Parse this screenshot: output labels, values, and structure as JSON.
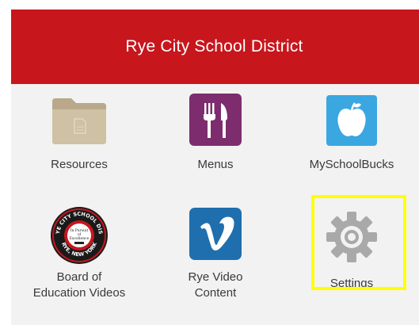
{
  "header": {
    "title": "Rye City School District"
  },
  "tiles": [
    {
      "label": "Resources",
      "icon": "folder-icon"
    },
    {
      "label": "Menus",
      "icon": "fork-knife-icon"
    },
    {
      "label": "MySchoolBucks",
      "icon": "apple-icon"
    },
    {
      "label": "Board of\nEducation Videos",
      "icon": "school-seal-icon"
    },
    {
      "label": "Rye Video\nContent",
      "icon": "vimeo-icon"
    },
    {
      "label": "Settings",
      "icon": "gear-icon"
    }
  ],
  "seal": {
    "ring_top": "THE RYE CITY SCHOOL DISTRICT",
    "ring_bottom": "RYE, NEW YORK",
    "motto_line1": "In Pursuit",
    "motto_line2": "of",
    "motto_line3": "Excellence"
  },
  "colors": {
    "header_bg": "#c8161d",
    "grid_bg": "#f2f2f2",
    "menus_purple": "#7d2d6e",
    "apple_blue": "#3aa7e0",
    "vimeo_blue": "#1f6fae",
    "highlight": "#ffff00"
  }
}
